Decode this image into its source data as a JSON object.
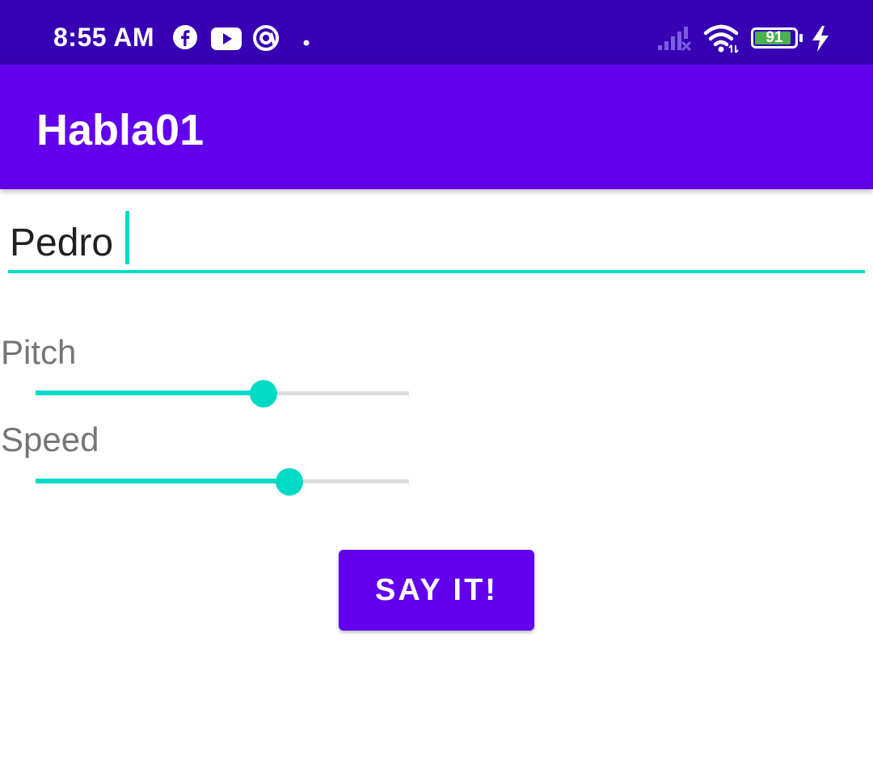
{
  "status_bar": {
    "time": "8:55 AM",
    "battery_level": "91",
    "icons": [
      "facebook-icon",
      "youtube-icon",
      "at-sign-icon",
      "notification-dot-icon",
      "cell-signal-icon",
      "wifi-icon",
      "battery-icon",
      "charging-bolt-icon"
    ]
  },
  "app_bar": {
    "title": "Habla01"
  },
  "form": {
    "name_value": "Pedro",
    "pitch_label": "Pitch",
    "pitch_value": 0.61,
    "speed_label": "Speed",
    "speed_value": 0.68,
    "button_label": "SAY IT!"
  },
  "colors": {
    "status_bar": "#3700b3",
    "primary": "#6200ee",
    "accent": "#03dac5",
    "battery_green": "#4caf50"
  }
}
